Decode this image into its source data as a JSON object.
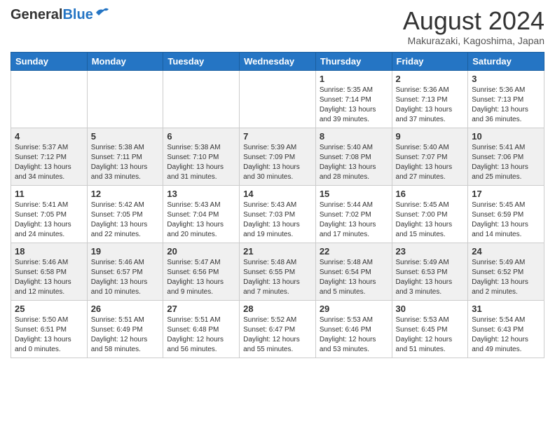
{
  "header": {
    "logo_general": "General",
    "logo_blue": "Blue",
    "month_title": "August 2024",
    "location": "Makurazaki, Kagoshima, Japan"
  },
  "weekdays": [
    "Sunday",
    "Monday",
    "Tuesday",
    "Wednesday",
    "Thursday",
    "Friday",
    "Saturday"
  ],
  "weeks": [
    [
      {
        "day": "",
        "info": ""
      },
      {
        "day": "",
        "info": ""
      },
      {
        "day": "",
        "info": ""
      },
      {
        "day": "",
        "info": ""
      },
      {
        "day": "1",
        "info": "Sunrise: 5:35 AM\nSunset: 7:14 PM\nDaylight: 13 hours\nand 39 minutes."
      },
      {
        "day": "2",
        "info": "Sunrise: 5:36 AM\nSunset: 7:13 PM\nDaylight: 13 hours\nand 37 minutes."
      },
      {
        "day": "3",
        "info": "Sunrise: 5:36 AM\nSunset: 7:13 PM\nDaylight: 13 hours\nand 36 minutes."
      }
    ],
    [
      {
        "day": "4",
        "info": "Sunrise: 5:37 AM\nSunset: 7:12 PM\nDaylight: 13 hours\nand 34 minutes."
      },
      {
        "day": "5",
        "info": "Sunrise: 5:38 AM\nSunset: 7:11 PM\nDaylight: 13 hours\nand 33 minutes."
      },
      {
        "day": "6",
        "info": "Sunrise: 5:38 AM\nSunset: 7:10 PM\nDaylight: 13 hours\nand 31 minutes."
      },
      {
        "day": "7",
        "info": "Sunrise: 5:39 AM\nSunset: 7:09 PM\nDaylight: 13 hours\nand 30 minutes."
      },
      {
        "day": "8",
        "info": "Sunrise: 5:40 AM\nSunset: 7:08 PM\nDaylight: 13 hours\nand 28 minutes."
      },
      {
        "day": "9",
        "info": "Sunrise: 5:40 AM\nSunset: 7:07 PM\nDaylight: 13 hours\nand 27 minutes."
      },
      {
        "day": "10",
        "info": "Sunrise: 5:41 AM\nSunset: 7:06 PM\nDaylight: 13 hours\nand 25 minutes."
      }
    ],
    [
      {
        "day": "11",
        "info": "Sunrise: 5:41 AM\nSunset: 7:05 PM\nDaylight: 13 hours\nand 24 minutes."
      },
      {
        "day": "12",
        "info": "Sunrise: 5:42 AM\nSunset: 7:05 PM\nDaylight: 13 hours\nand 22 minutes."
      },
      {
        "day": "13",
        "info": "Sunrise: 5:43 AM\nSunset: 7:04 PM\nDaylight: 13 hours\nand 20 minutes."
      },
      {
        "day": "14",
        "info": "Sunrise: 5:43 AM\nSunset: 7:03 PM\nDaylight: 13 hours\nand 19 minutes."
      },
      {
        "day": "15",
        "info": "Sunrise: 5:44 AM\nSunset: 7:02 PM\nDaylight: 13 hours\nand 17 minutes."
      },
      {
        "day": "16",
        "info": "Sunrise: 5:45 AM\nSunset: 7:00 PM\nDaylight: 13 hours\nand 15 minutes."
      },
      {
        "day": "17",
        "info": "Sunrise: 5:45 AM\nSunset: 6:59 PM\nDaylight: 13 hours\nand 14 minutes."
      }
    ],
    [
      {
        "day": "18",
        "info": "Sunrise: 5:46 AM\nSunset: 6:58 PM\nDaylight: 13 hours\nand 12 minutes."
      },
      {
        "day": "19",
        "info": "Sunrise: 5:46 AM\nSunset: 6:57 PM\nDaylight: 13 hours\nand 10 minutes."
      },
      {
        "day": "20",
        "info": "Sunrise: 5:47 AM\nSunset: 6:56 PM\nDaylight: 13 hours\nand 9 minutes."
      },
      {
        "day": "21",
        "info": "Sunrise: 5:48 AM\nSunset: 6:55 PM\nDaylight: 13 hours\nand 7 minutes."
      },
      {
        "day": "22",
        "info": "Sunrise: 5:48 AM\nSunset: 6:54 PM\nDaylight: 13 hours\nand 5 minutes."
      },
      {
        "day": "23",
        "info": "Sunrise: 5:49 AM\nSunset: 6:53 PM\nDaylight: 13 hours\nand 3 minutes."
      },
      {
        "day": "24",
        "info": "Sunrise: 5:49 AM\nSunset: 6:52 PM\nDaylight: 13 hours\nand 2 minutes."
      }
    ],
    [
      {
        "day": "25",
        "info": "Sunrise: 5:50 AM\nSunset: 6:51 PM\nDaylight: 13 hours\nand 0 minutes."
      },
      {
        "day": "26",
        "info": "Sunrise: 5:51 AM\nSunset: 6:49 PM\nDaylight: 12 hours\nand 58 minutes."
      },
      {
        "day": "27",
        "info": "Sunrise: 5:51 AM\nSunset: 6:48 PM\nDaylight: 12 hours\nand 56 minutes."
      },
      {
        "day": "28",
        "info": "Sunrise: 5:52 AM\nSunset: 6:47 PM\nDaylight: 12 hours\nand 55 minutes."
      },
      {
        "day": "29",
        "info": "Sunrise: 5:53 AM\nSunset: 6:46 PM\nDaylight: 12 hours\nand 53 minutes."
      },
      {
        "day": "30",
        "info": "Sunrise: 5:53 AM\nSunset: 6:45 PM\nDaylight: 12 hours\nand 51 minutes."
      },
      {
        "day": "31",
        "info": "Sunrise: 5:54 AM\nSunset: 6:43 PM\nDaylight: 12 hours\nand 49 minutes."
      }
    ]
  ],
  "row_colors": [
    "#ffffff",
    "#f0f0f0",
    "#ffffff",
    "#f0f0f0",
    "#ffffff"
  ]
}
